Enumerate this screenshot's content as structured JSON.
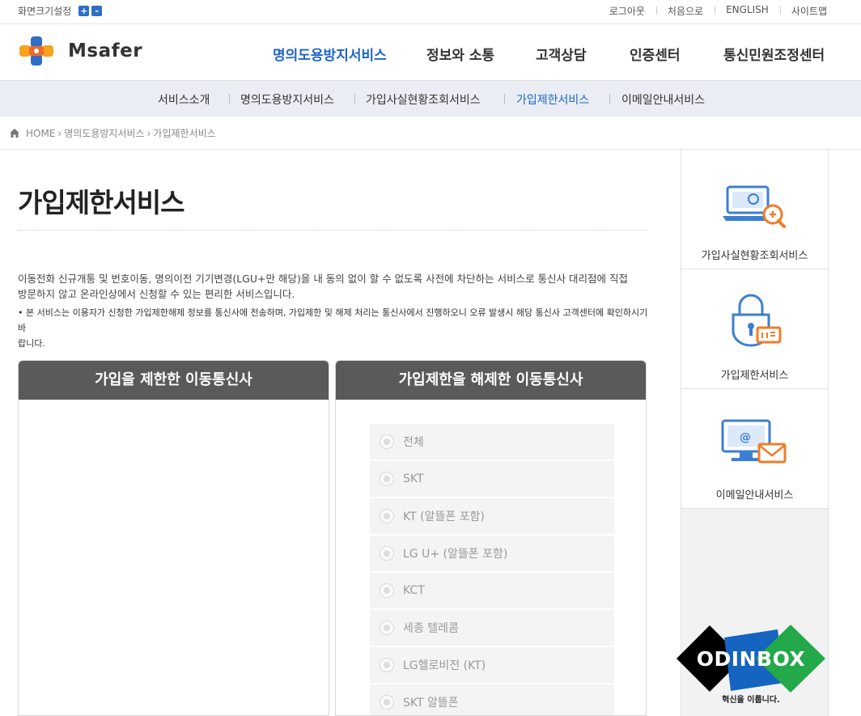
{
  "topbar": {
    "font_size_label": "화면크기설정",
    "increase": "+",
    "decrease": "-",
    "links": [
      "로그아웃",
      "처음으로",
      "ENGLISH",
      "사이트맵"
    ]
  },
  "logo": {
    "text": "Msafer"
  },
  "gnb": {
    "items": [
      "명의도용방지서비스",
      "정보와 소통",
      "고객상담",
      "인증센터",
      "통신민원조정센터"
    ],
    "active_index": 0
  },
  "subnav": {
    "items": [
      "서비스소개",
      "명의도용방지서비스",
      "가입사실현황조회서비스",
      "가입제한서비스",
      "이메일안내서비스"
    ],
    "active_index": 3
  },
  "breadcrumb": {
    "home": "HOME",
    "level1": "명의도용방지서비스",
    "level2": "가입제한서비스"
  },
  "page": {
    "title": "가입제한서비스",
    "description_line1": "이동전화 신규개통 및 번호이동, 명의이전 기기변경(LGU+만 해당)을 내 동의 없이 할 수 없도록 사전에 차단하는 서비스로 통신사 대리점에 직접",
    "description_line2": "방문하지 않고 온라인상에서 신청할 수 있는 편리한 서비스입니다.",
    "notice_line1": "• 본 서비스는 이용자가 신청한 가입제한해제 정보를 통신사에 전송하며, 가입제한 및 해제 처리는 통신사에서 진행하오니 오류 발생시 해당 통신사 고객센터에 확인하시기 바",
    "notice_line2": "랍니다."
  },
  "panels": {
    "restricted_title": "가입을 제한한 이동통신사",
    "released_title": "가입제한을 해제한 이동통신사",
    "options": [
      "전체",
      "SKT",
      "KT (알뜰폰 포함)",
      "LG U+ (알뜰폰 포함)",
      "KCT",
      "세종 텔레콤",
      "LG헬로비전 (KT)",
      "SKT 알뜰폰"
    ]
  },
  "sidebar": {
    "items": [
      "가입사실현황조회서비스",
      "가입제한서비스",
      "이메일안내서비스"
    ]
  },
  "watermark": {
    "brand": "ODINBOX",
    "tagline": "혁신을 이룹니다."
  },
  "colors": {
    "accent": "#1e64c8",
    "panel_header": "#5a5a5a",
    "icon_blue": "#3c7fd2",
    "icon_orange": "#f07c28"
  }
}
